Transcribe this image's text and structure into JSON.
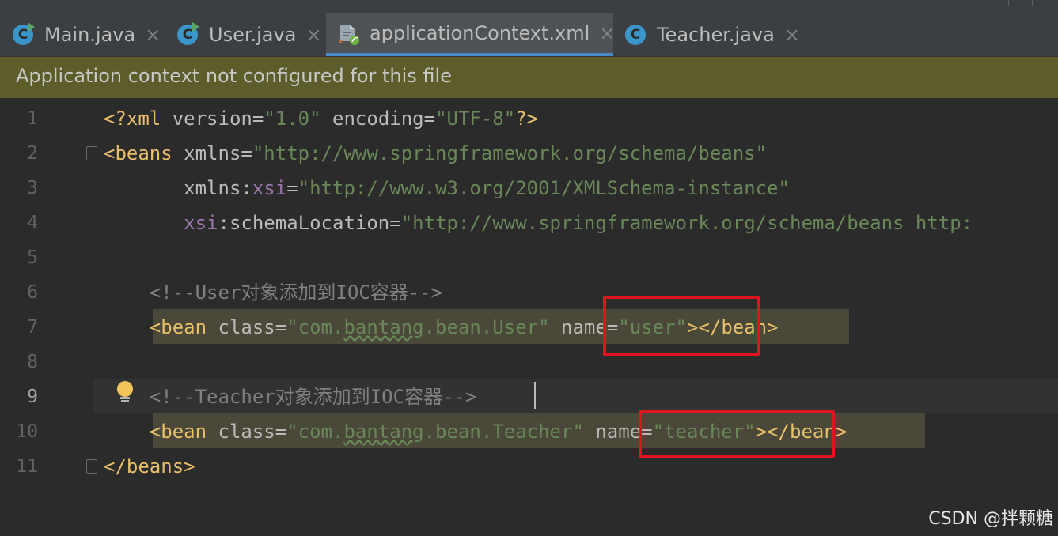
{
  "tabs": [
    {
      "label": "Main.java",
      "icon": "java-class-run-icon",
      "active": false
    },
    {
      "label": "User.java",
      "icon": "java-class-run-icon",
      "active": false
    },
    {
      "label": "applicationContext.xml",
      "icon": "spring-xml-file-icon",
      "active": true
    },
    {
      "label": "Teacher.java",
      "icon": "java-class-icon",
      "active": false
    }
  ],
  "tab_close_glyph": "×",
  "class_glyph": "C",
  "banner": {
    "text": "Application context not configured for this file"
  },
  "line_numbers": [
    "1",
    "2",
    "3",
    "4",
    "5",
    "6",
    "7",
    "8",
    "9",
    "10",
    "11"
  ],
  "current_line": "9",
  "code": {
    "l1": {
      "open": "<?xml ",
      "a1": "version",
      "eq1": "=",
      "v1": "\"1.0\"",
      "sp": " ",
      "a2": "encoding",
      "eq2": "=",
      "v2": "\"UTF-8\"",
      "close": "?>"
    },
    "l2": {
      "open": "<beans ",
      "a1": "xmlns",
      "eq": "=",
      "v1": "\"http://www.springframework.org/schema/beans\""
    },
    "l3": {
      "indent": "       ",
      "ns_prefix": "xmlns:",
      "ns": "xsi",
      "eq": "=",
      "v1": "\"http://www.w3.org/2001/XMLSchema-instance\""
    },
    "l4": {
      "indent": "       ",
      "ns": "xsi",
      "colon_attr": ":schemaLocation",
      "eq": "=",
      "v1": "\"http://www.springframework.org/schema/beans http:"
    },
    "l6": {
      "indent": "    ",
      "comment": "<!--User对象添加到IOC容器-->"
    },
    "l7": {
      "indent": "    ",
      "open": "<bean ",
      "a1": "class",
      "eq1": "=",
      "q1": "\"com.",
      "w1": "bantang",
      "r1": ".bean.User\"",
      "sp": " ",
      "a2": "name",
      "eq2": "=",
      "v2": "\"user\"",
      "gt": ">",
      "end": "</bean>"
    },
    "l9": {
      "indent": "    ",
      "comment": "<!--Teacher对象添加到IOC容器-->"
    },
    "l10": {
      "indent": "    ",
      "open": "<bean ",
      "a1": "class",
      "eq1": "=",
      "q1": "\"com.",
      "w1": "bantang",
      "r1": ".bean.Teacher\"",
      "sp": " ",
      "a2": "name",
      "eq2": "=",
      "v2": "\"teacher\"",
      "gt": ">",
      "end": "</bean>"
    },
    "l11": {
      "end": "</beans>"
    }
  },
  "watermark": "CSDN @拌颗糖",
  "colors": {
    "editor_bg": "#2b2b2b",
    "banner_bg": "#5c5d2a",
    "tag": "#e8bf6a",
    "string": "#6a8759",
    "namespace": "#9876aa",
    "comment": "#808080",
    "annotation_box": "#e0141e",
    "active_tab_underline": "#4a88c7"
  }
}
